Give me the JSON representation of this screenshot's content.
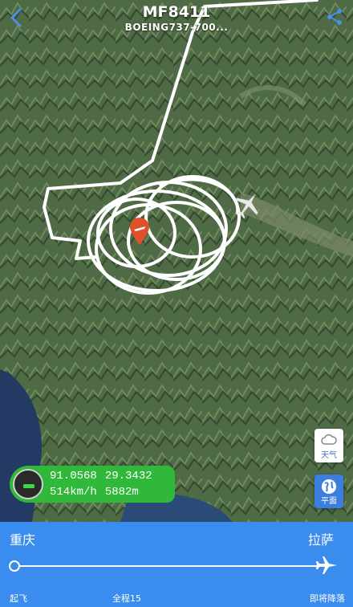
{
  "header": {
    "flight_number": "MF8411",
    "aircraft": "BOEING737-700..."
  },
  "flight_info": {
    "longitude": "91.0568",
    "latitude": "29.3432",
    "speed": "514km/h",
    "altitude": "5882m"
  },
  "controls": {
    "weather_label": "天气",
    "map_mode_label": "平面"
  },
  "route": {
    "origin": "重庆",
    "destination": "拉萨",
    "takeoff_label": "起飞",
    "total_label": "全程15",
    "landing_label": "即将降落",
    "progress": 0.98
  },
  "colors": {
    "accent": "#3a8cee",
    "info_green": "#2fb83a",
    "marker": "#e0502a"
  },
  "icons": {
    "back": "chevron-left-icon",
    "share": "share-icon",
    "weather": "cloud-icon",
    "map_mode": "globe-icon",
    "airport": "airport-marker-icon",
    "plane": "plane-icon"
  }
}
